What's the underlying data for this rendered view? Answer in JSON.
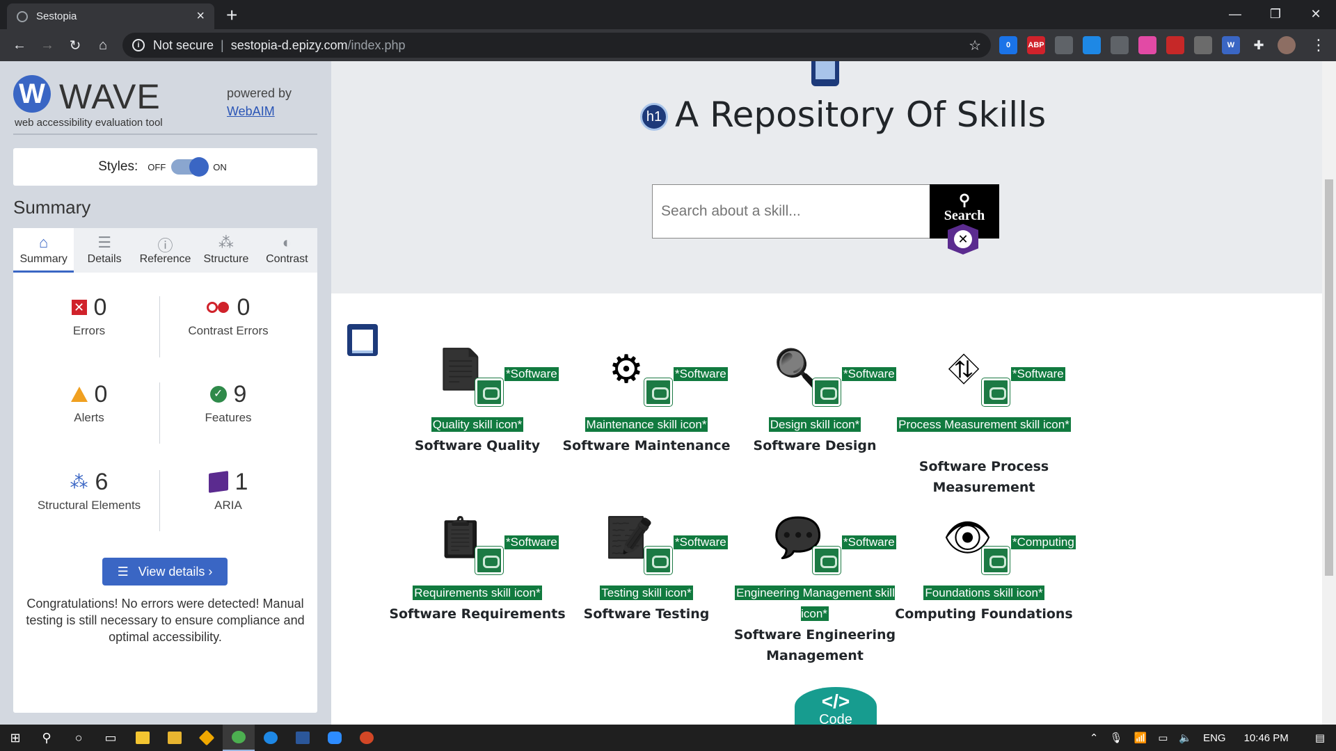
{
  "browser": {
    "tab_title": "Sestopia",
    "new_tab": "+",
    "security_label": "Not secure",
    "url_host": "sestopia-d.epizy.com",
    "url_path": "/index.php",
    "extensions": [
      {
        "name": "ext-badge",
        "label": "0",
        "color": "#1a73e8"
      },
      {
        "name": "adblock-plus",
        "label": "ABP",
        "color": "#d0222b"
      },
      {
        "name": "bulb",
        "label": "",
        "color": "#5f6368"
      },
      {
        "name": "screen",
        "label": "",
        "color": "#1e88e5"
      },
      {
        "name": "camera",
        "label": "",
        "color": "#5f6368"
      },
      {
        "name": "color-grid",
        "label": "",
        "color": "#e24aa5"
      },
      {
        "name": "pdf",
        "label": "",
        "color": "#c62828"
      },
      {
        "name": "reader",
        "label": "",
        "color": "#6b6b6b"
      },
      {
        "name": "wave-ext",
        "label": "W",
        "color": "#3a66c4"
      }
    ]
  },
  "wave": {
    "logo_letter": "W",
    "name": "WAVE",
    "tagline": "web accessibility evaluation tool",
    "powered_by": "powered by",
    "webaim": "WebAIM",
    "styles_label": "Styles:",
    "styles_off": "OFF",
    "styles_on": "ON",
    "summary_heading": "Summary",
    "tabs": [
      {
        "label": "Summary",
        "icon": "home-icon",
        "glyph": "⌂",
        "active": true
      },
      {
        "label": "Details",
        "icon": "list-icon",
        "glyph": "☰",
        "active": false
      },
      {
        "label": "Reference",
        "icon": "info-icon",
        "glyph": "ⓘ",
        "active": false
      },
      {
        "label": "Structure",
        "icon": "hierarchy-icon",
        "glyph": "⁂",
        "active": false
      },
      {
        "label": "Contrast",
        "icon": "contrast-icon",
        "glyph": "◐",
        "active": false
      }
    ],
    "stats": {
      "errors": {
        "count": "0",
        "label": "Errors"
      },
      "contrast_errors": {
        "count": "0",
        "label": "Contrast Errors"
      },
      "alerts": {
        "count": "0",
        "label": "Alerts"
      },
      "features": {
        "count": "9",
        "label": "Features"
      },
      "structural": {
        "count": "6",
        "label": "Structural Elements"
      },
      "aria": {
        "count": "1",
        "label": "ARIA"
      }
    },
    "view_details": "View details ›",
    "congrats": "Congratulations! No errors were detected! Manual testing is still necessary to ensure compliance and optimal accessibility.",
    "colors": {
      "accent": "#3a66c4",
      "error": "#d0222b",
      "alert": "#f0a020",
      "feature": "#2f8a4a",
      "aria": "#5b2b8f"
    }
  },
  "page": {
    "h1_badge": "h1",
    "heading": "A Repository Of Skills",
    "search_placeholder": "Search about a skill...",
    "search_button": "Search",
    "code_button": "Code",
    "code_symbol": "</>",
    "skills": [
      {
        "alt_a": "*Software",
        "alt_b": "Quality skill icon*",
        "name": "Software Quality",
        "icon": "document-check-icon"
      },
      {
        "alt_a": "*Software",
        "alt_b": "Maintenance skill icon*",
        "name": "Software Maintenance",
        "icon": "code-gear-icon"
      },
      {
        "alt_a": "*Software",
        "alt_b": "Design skill icon*",
        "name": "Software Design",
        "icon": "person-search-icon"
      },
      {
        "alt_a": "*Software",
        "alt_b": "Process Measurement skill icon*",
        "name": "Software Process Measurement",
        "icon": "flowchart-icon"
      },
      {
        "alt_a": "*Software",
        "alt_b": "Requirements skill icon*",
        "name": "Software Requirements",
        "icon": "clipboard-list-icon"
      },
      {
        "alt_a": "*Software",
        "alt_b": "Testing skill icon*",
        "name": "Software Testing",
        "icon": "checklist-pen-icon"
      },
      {
        "alt_a": "*Software",
        "alt_b": "Engineering Management skill icon*",
        "name": "Software Engineering Management",
        "icon": "person-chat-icon"
      },
      {
        "alt_a": "*Computing",
        "alt_b": "Foundations skill icon*",
        "name": "Computing Foundations",
        "icon": "eye-search-icon"
      }
    ]
  },
  "taskbar": {
    "language": "ENG",
    "time": "10:46 PM"
  }
}
